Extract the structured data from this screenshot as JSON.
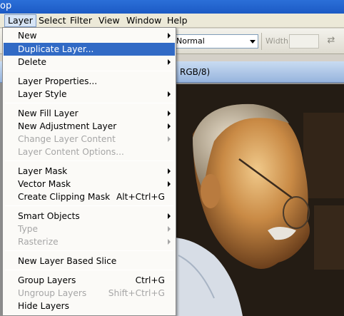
{
  "app": {
    "title_fragment": "op"
  },
  "menubar": {
    "items": [
      "Layer",
      "Select",
      "Filter",
      "View",
      "Window",
      "Help"
    ],
    "active": "Layer"
  },
  "options_bar": {
    "blend_mode": "Normal",
    "width_label": "Width:"
  },
  "document": {
    "title_fragment": "RGB/8)"
  },
  "layer_menu": {
    "items": [
      {
        "label": "New",
        "submenu": true
      },
      {
        "label": "Duplicate Layer...",
        "highlighted": true
      },
      {
        "label": "Delete",
        "submenu": true
      },
      {
        "label": "Layer Properties..."
      },
      {
        "label": "Layer Style",
        "submenu": true
      },
      {
        "label": "New Fill Layer",
        "submenu": true
      },
      {
        "label": "New Adjustment Layer",
        "submenu": true
      },
      {
        "label": "Change Layer Content",
        "submenu": true,
        "disabled": true
      },
      {
        "label": "Layer Content Options...",
        "disabled": true
      },
      {
        "label": "Layer Mask",
        "submenu": true
      },
      {
        "label": "Vector Mask",
        "submenu": true
      },
      {
        "label": "Create Clipping Mask",
        "shortcut": "Alt+Ctrl+G"
      },
      {
        "label": "Smart Objects",
        "submenu": true
      },
      {
        "label": "Type",
        "submenu": true,
        "disabled": true
      },
      {
        "label": "Rasterize",
        "submenu": true,
        "disabled": true
      },
      {
        "label": "New Layer Based Slice"
      },
      {
        "label": "Group Layers",
        "shortcut": "Ctrl+G"
      },
      {
        "label": "Ungroup Layers",
        "shortcut": "Shift+Ctrl+G",
        "disabled": true
      },
      {
        "label": "Hide Layers"
      }
    ]
  },
  "colors": {
    "highlight": "#316ac5",
    "disabled_text": "#a6a6a6",
    "title_bar": "#1c5ac4"
  }
}
